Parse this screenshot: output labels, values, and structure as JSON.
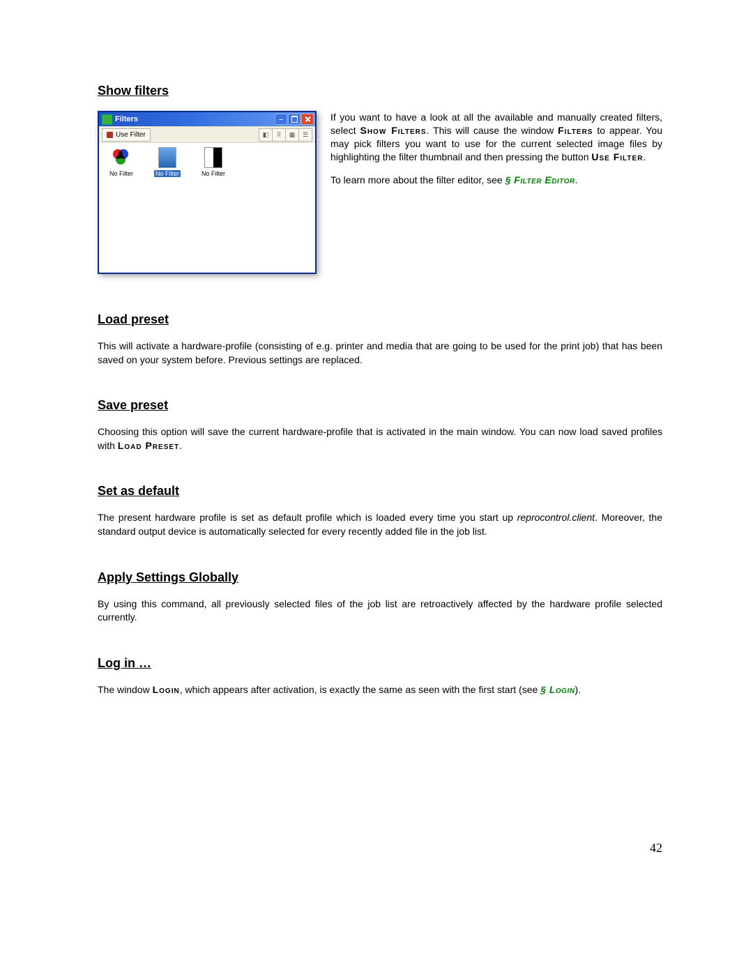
{
  "page_number": "42",
  "sections": {
    "show_filters": {
      "heading": "Show filters",
      "para1_a": "If you want to have a look at all the available and manually created filters, select ",
      "para1_cmd1": "Show Filters",
      "para1_b": ". This will cause the window ",
      "para1_cmd2": "Filters",
      "para1_c": " to appear. You may pick filters you want to use for the current selected image files by highlighting the filter thumbnail and then pressing the button ",
      "para1_cmd3": "Use Filter",
      "para1_d": ".",
      "para2_a": "To learn more about the filter editor, see ",
      "para2_ref": "§ Filter Editor",
      "para2_b": "."
    },
    "load_preset": {
      "heading": "Load preset",
      "body": "This will activate a hardware-profile (consisting of e.g. printer and media that are going to be used for the print job) that has been saved on your system before. Previous settings are replaced."
    },
    "save_preset": {
      "heading": "Save preset",
      "body_a": "Choosing this option will save the current hardware-profile that is activated in the main window. You can now load saved profiles with ",
      "cmd": "Load Preset",
      "body_b": "."
    },
    "set_default": {
      "heading": "Set as default",
      "body_a": "The present hardware profile is set as default profile which is loaded every time you start up ",
      "app": "reprocontrol.client",
      "body_b": ". Moreover, the standard output device is automatically selected for every recently added file in the job list."
    },
    "apply_global": {
      "heading": "Apply Settings Globally",
      "body": "By using this command, all previously selected files of the job list are retroactively affected by the hardware profile selected currently."
    },
    "login": {
      "heading": "Log in …",
      "body_a": "The window ",
      "cmd": "Login",
      "body_b": ", which appears after activation, is exactly the same as seen with the first start (see ",
      "ref": "§ Login",
      "body_c": ")."
    }
  },
  "filters_window": {
    "title": "Filters",
    "use_filter_label": "Use Filter",
    "thumbs": [
      {
        "label": "No Filter"
      },
      {
        "label": "No Filter"
      },
      {
        "label": "No Filter"
      }
    ],
    "view_icons": [
      "◧",
      "⠿",
      "▦",
      "☰"
    ]
  }
}
